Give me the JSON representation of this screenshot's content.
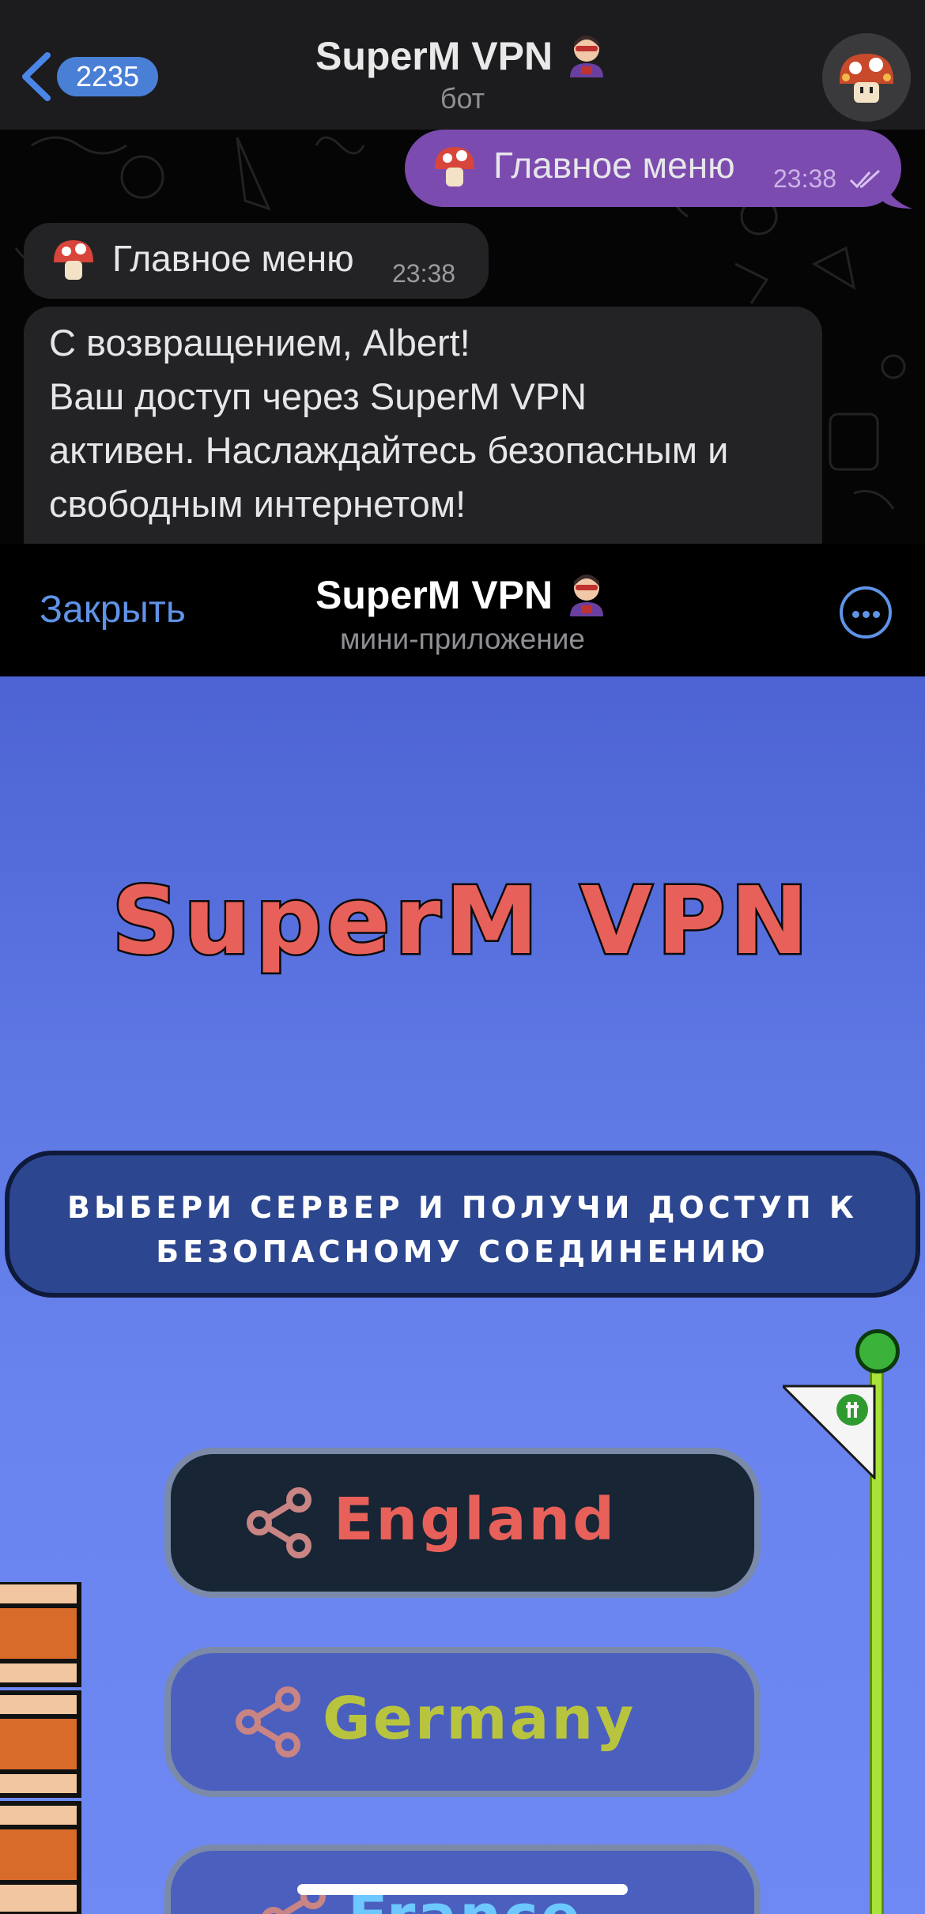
{
  "chat": {
    "back_badge": "2235",
    "title": "SuperM VPN",
    "subtitle": "бот",
    "messages": {
      "outgoing": {
        "text": "Главное меню",
        "time": "23:38"
      },
      "incoming_menu": {
        "text": "Главное меню",
        "time": "23:38"
      },
      "welcome": {
        "line1": "С возвращением, Albert!",
        "line2": "Ваш доступ через SuperM VPN",
        "line3": "активен. Наслаждайтесь безопасным и",
        "line4": "свободным интернетом!"
      }
    }
  },
  "miniapp": {
    "close_label": "Закрыть",
    "title": "SuperM VPN",
    "subtitle": "мини-приложение"
  },
  "webapp": {
    "logo_text": "SuperM VPN",
    "info_text": "ВЫБЕРИ СЕРВЕР И ПОЛУЧИ ДОСТУП К БЕЗОПАСНОМУ СОЕДИНЕНИЮ",
    "servers": [
      {
        "label": "England",
        "label_color": "#e8605a",
        "icon_color": "#c98484",
        "selected": true
      },
      {
        "label": "Germany",
        "label_color": "#b9c43e",
        "icon_color": "#c98484",
        "selected": false
      },
      {
        "label": "France",
        "label_color": "#6cc8ff",
        "icon_color": "#c98484",
        "selected": false
      }
    ]
  },
  "colors": {
    "outgoing_bubble": "#7c4bb0",
    "incoming_bubble": "#232326",
    "accent_link": "#5f93e6",
    "logo_fill": "#e8605a",
    "info_box": "#2c4690"
  },
  "icons": [
    "back-chevron-icon",
    "mushroom-icon",
    "superhero-icon",
    "read-checkmarks-icon",
    "more-dots-icon",
    "share-icon",
    "flag-icon"
  ]
}
